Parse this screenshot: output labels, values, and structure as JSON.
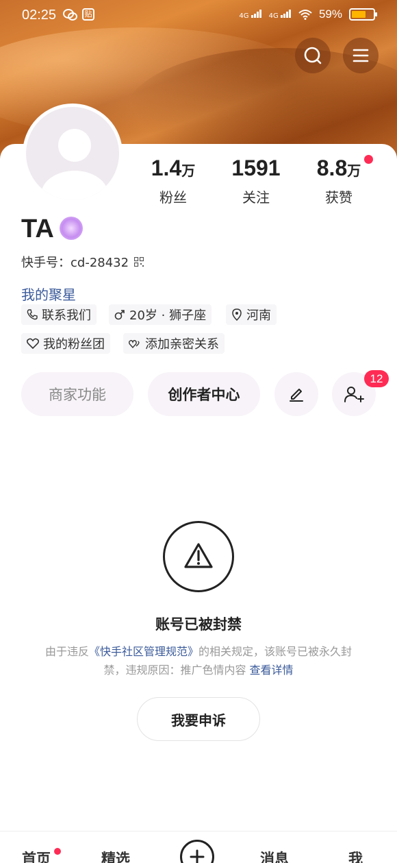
{
  "status_bar": {
    "time": "02:25",
    "app_icon_label": "贴",
    "network_1": "4G",
    "network_2": "4G",
    "battery_percent": "59%",
    "battery_level": 0.59
  },
  "header": {
    "search_icon": "search-icon",
    "menu_icon": "menu-icon"
  },
  "profile": {
    "stats": [
      {
        "value": "1.4",
        "unit": "万",
        "label": "粉丝"
      },
      {
        "value": "1591",
        "unit": "",
        "label": "关注"
      },
      {
        "value": "8.8",
        "unit": "万",
        "label": "获赞"
      }
    ],
    "name": "TA",
    "kuaishou_id_label": "快手号：",
    "kuaishou_id": "cd-28432",
    "juxing": "我的聚星",
    "tags": {
      "contact": "联系我们",
      "age_sign": "20岁 · 狮子座",
      "location": "河南",
      "fan_group": "我的粉丝团",
      "intimate": "添加亲密关系"
    }
  },
  "actions": {
    "merchant": "商家功能",
    "creator": "创作者中心",
    "friend_requests": "12"
  },
  "ban": {
    "title": "账号已被封禁",
    "desc_prefix": "由于违反",
    "desc_link": "《快手社区管理规范》",
    "desc_middle": "的相关规定，该账号已被永久封禁，违规原因：推广色情内容",
    "details_link": "查看详情",
    "appeal_button": "我要申诉"
  },
  "bottom_nav": {
    "home": "首页",
    "featured": "精选",
    "messages": "消息",
    "me": "我"
  },
  "colors": {
    "accent_red": "#fe2c55",
    "link_blue": "#3a5a9a"
  }
}
